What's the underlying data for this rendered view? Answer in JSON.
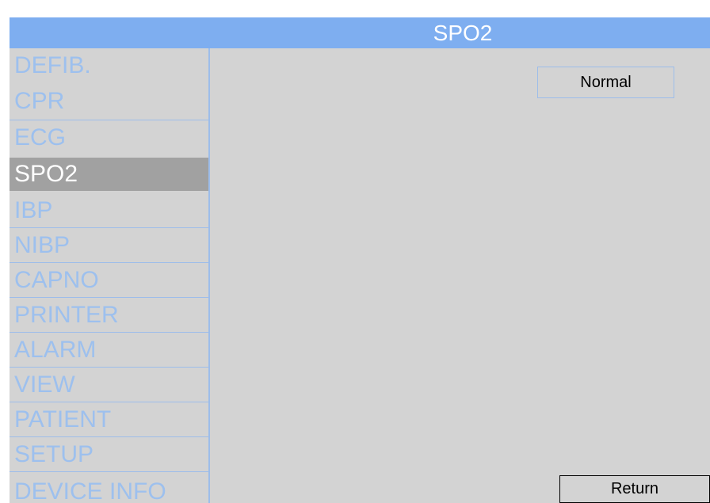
{
  "header": {
    "title": "SPO2"
  },
  "sidebar": {
    "items": [
      {
        "label": "DEFIB."
      },
      {
        "label": "CPR"
      },
      {
        "label": "ECG"
      },
      {
        "label": "SPO2",
        "selected": true
      },
      {
        "label": "IBP"
      },
      {
        "label": "NIBP"
      },
      {
        "label": "CAPNO"
      },
      {
        "label": "PRINTER"
      },
      {
        "label": "ALARM"
      },
      {
        "label": "VIEW"
      },
      {
        "label": "PATIENT"
      },
      {
        "label": "SETUP"
      },
      {
        "label": "DEVICE INFO"
      }
    ]
  },
  "content": {
    "mode_value": "Normal",
    "return_label": "Return"
  },
  "colors": {
    "header_bg": "#7eaef0",
    "panel_bg": "#d3d3d3",
    "menu_text": "#9dc0ee",
    "selected_bg": "#a1a1a1"
  }
}
